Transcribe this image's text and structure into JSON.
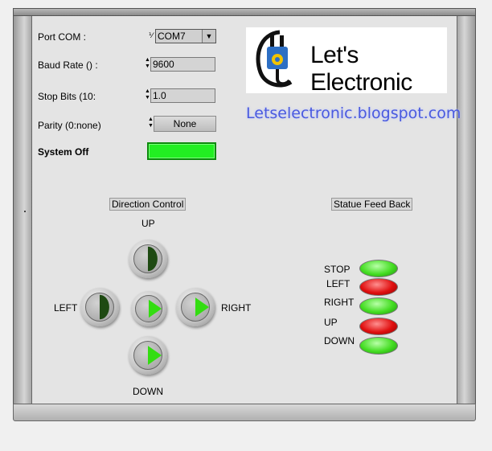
{
  "settings": {
    "port_label": "Port COM :",
    "port_value": "COM7",
    "port_prefix": "I/O",
    "baud_label": "Baud Rate () :",
    "baud_value": "9600",
    "stop_label": "Stop Bits (10:",
    "stop_value": "1.0",
    "parity_label": "Parity (0:none)",
    "parity_value": "None",
    "system_label": "System Off",
    "system_led_color": "#22ee22"
  },
  "logo": {
    "text": "Let's Electronic",
    "url": "Letselectronic.blogspot.com"
  },
  "direction": {
    "title": "Direction Control",
    "up": "UP",
    "down": "DOWN",
    "left": "LEFT",
    "right": "RIGHT"
  },
  "feedback": {
    "title": "Statue Feed Back",
    "items": [
      {
        "label": "STOP",
        "state": "green"
      },
      {
        "label": "LEFT",
        "state": "red"
      },
      {
        "label": "RIGHT",
        "state": "green"
      },
      {
        "label": "UP",
        "state": "red"
      },
      {
        "label": "DOWN",
        "state": "green"
      }
    ]
  },
  "colors": {
    "led_on": "#44dd22",
    "led_alarm": "#e01010",
    "button_indicator_dark": "#1e4a12",
    "button_indicator_bright": "#33dd11"
  }
}
